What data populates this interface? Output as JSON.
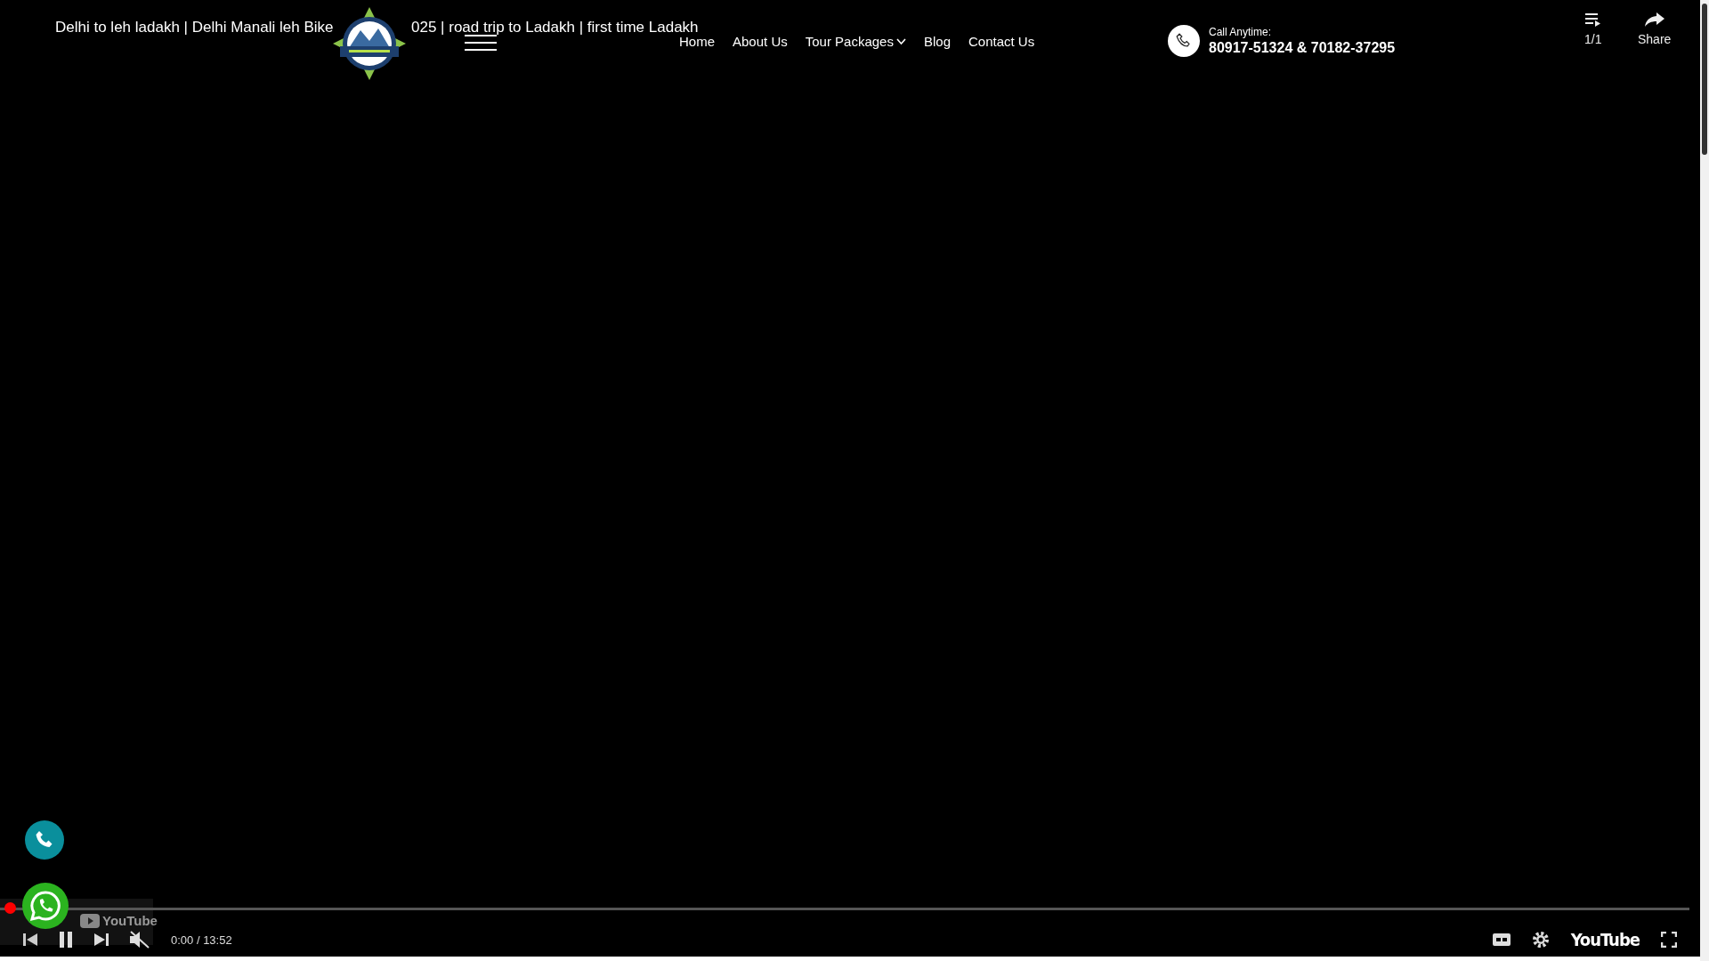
{
  "video": {
    "title_start": "Delhi to leh ladakh | Delhi Manali leh Bike",
    "title_end": "025 | road trip to Ladakh | first time Ladakh",
    "playlist_count": "1/1",
    "share_label": "Share"
  },
  "nav": {
    "items": [
      {
        "label": "Home",
        "has_dropdown": false
      },
      {
        "label": "About Us",
        "has_dropdown": false
      },
      {
        "label": "Tour Packages",
        "has_dropdown": true
      },
      {
        "label": "Blog",
        "has_dropdown": false
      },
      {
        "label": "Contact Us",
        "has_dropdown": false
      }
    ]
  },
  "contact": {
    "label": "Call Anytime:",
    "phones": "80917-51324 & 70182-37295"
  },
  "player": {
    "playing": true,
    "muted": true,
    "level": 0,
    "time": "0:00 / 13:52",
    "overlay_logo": "YouTube",
    "brand": "YouTube"
  }
}
